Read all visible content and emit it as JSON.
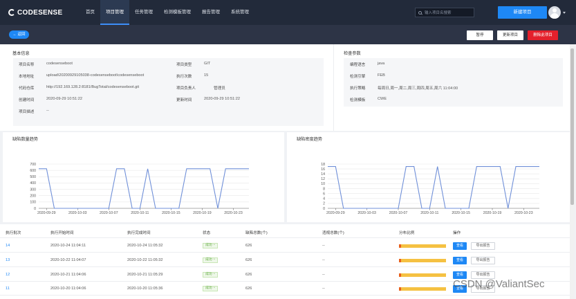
{
  "brand": {
    "name": "CODESENSE"
  },
  "nav": {
    "items": [
      "首页",
      "项目管理",
      "任务管理",
      "检测模板管理",
      "报告管理",
      "系统管理"
    ]
  },
  "search": {
    "placeholder": "输入项目名搜索"
  },
  "header": {
    "new_project_label": "新建项目"
  },
  "subbar": {
    "back_label": "← 返回",
    "pause_label": "暂停",
    "update_label": "更新项目",
    "delete_label": "删除此项目"
  },
  "basic_info": {
    "title": "基本信息",
    "fields": {
      "project_name": {
        "label": "项目名称",
        "value": "codesenseboot"
      },
      "local_address": {
        "label": "本地地址",
        "value": "upload\\20200929105038-codesenseboot\\codesenseboot"
      },
      "repo": {
        "label": "代码仓库",
        "value": "http://192.169.128.2:8181/BugTotal/codesenseboot.git"
      },
      "created_at": {
        "label": "创建时间",
        "value": "2020-09-29 10:51:22"
      },
      "description": {
        "label": "项目描述",
        "value": "--"
      },
      "project_type": {
        "label": "项目类型",
        "value": "GIT"
      },
      "exec_count": {
        "label": "执行次数",
        "value": "15"
      },
      "owner": {
        "label": "项目负责人",
        "value": "管理员"
      },
      "updated_at": {
        "label": "更新时间",
        "value": "2020-09-29 10:51:22"
      }
    }
  },
  "check_params": {
    "title": "检查参数",
    "fields": {
      "language": {
        "label": "编程语言",
        "value": "java"
      },
      "engine": {
        "label": "检测引擎",
        "value": "FEB"
      },
      "strategy": {
        "label": "执行策略",
        "value": "每周日,周一,周二,周三,周四,周五,周六 11:04:00"
      },
      "template": {
        "label": "检测模板",
        "value": "CWE"
      }
    }
  },
  "charts_meta": {
    "left_title": "缺陷数量趋势",
    "right_title": "缺陷密度趋势"
  },
  "chart_data": [
    {
      "type": "line",
      "title": "缺陷数量趋势",
      "xlabel": "",
      "ylabel": "",
      "x_ticks": [
        "2020-09-29",
        "2020-10-03",
        "2020-10-07",
        "2020-10-11",
        "2020-10-15",
        "2020-10-19",
        "2020-10-23"
      ],
      "x_range": [
        "2020-09-28",
        "2020-10-25"
      ],
      "y_ticks": [
        0,
        100,
        200,
        300,
        400,
        500,
        600,
        700
      ],
      "ylim": [
        0,
        700
      ],
      "grid": true,
      "color": "#6f8fd8",
      "series": [
        {
          "x": [
            "2020-09-28",
            "2020-09-29",
            "2020-09-30",
            "2020-10-01",
            "2020-10-02",
            "2020-10-03",
            "2020-10-04",
            "2020-10-05",
            "2020-10-06",
            "2020-10-07",
            "2020-10-08",
            "2020-10-09",
            "2020-10-10",
            "2020-10-11",
            "2020-10-12",
            "2020-10-13",
            "2020-10-14",
            "2020-10-15",
            "2020-10-16",
            "2020-10-17",
            "2020-10-18",
            "2020-10-19",
            "2020-10-20",
            "2020-10-21",
            "2020-10-22",
            "2020-10-23",
            "2020-10-24",
            "2020-10-25"
          ],
          "y": [
            626,
            626,
            0,
            0,
            0,
            0,
            0,
            0,
            0,
            0,
            626,
            626,
            0,
            0,
            626,
            0,
            0,
            0,
            0,
            626,
            626,
            626,
            626,
            0,
            626,
            626,
            626,
            626
          ]
        }
      ]
    },
    {
      "type": "line",
      "title": "缺陷密度趋势",
      "xlabel": "",
      "ylabel": "",
      "x_ticks": [
        "2020-09-29",
        "2020-10-03",
        "2020-10-07",
        "2020-10-11",
        "2020-10-15",
        "2020-10-19",
        "2020-10-23"
      ],
      "x_range": [
        "2020-09-28",
        "2020-10-25"
      ],
      "y_ticks": [
        0,
        2,
        4,
        6,
        8,
        10,
        12,
        14,
        16,
        18
      ],
      "ylim": [
        0,
        18
      ],
      "grid": true,
      "color": "#6f8fd8",
      "series": [
        {
          "x": [
            "2020-09-28",
            "2020-09-29",
            "2020-09-30",
            "2020-10-01",
            "2020-10-02",
            "2020-10-03",
            "2020-10-04",
            "2020-10-05",
            "2020-10-06",
            "2020-10-07",
            "2020-10-08",
            "2020-10-09",
            "2020-10-10",
            "2020-10-11",
            "2020-10-12",
            "2020-10-13",
            "2020-10-14",
            "2020-10-15",
            "2020-10-16",
            "2020-10-17",
            "2020-10-18",
            "2020-10-19",
            "2020-10-20",
            "2020-10-21",
            "2020-10-22",
            "2020-10-23",
            "2020-10-24",
            "2020-10-25"
          ],
          "y": [
            17,
            17,
            0,
            0,
            0,
            0,
            0,
            0,
            0,
            0,
            17,
            17,
            0,
            0,
            17,
            0,
            0,
            0,
            0,
            17,
            17,
            17,
            17,
            0,
            17,
            17,
            17,
            17
          ]
        }
      ]
    }
  ],
  "table": {
    "headers": [
      "执行批次",
      "执行开始时间",
      "执行完成时间",
      "状态",
      "缺陷总数(个)",
      "违规总数(个)",
      "分布比例",
      "操作"
    ],
    "view_label": "查看",
    "export_label": "导出报告",
    "rows": [
      {
        "batch": "14",
        "start": "2020-10-24 11:04:11",
        "end": "2020-10-24 11:05:32",
        "status": "成功 ◔",
        "defects": "626",
        "violations": "--",
        "distribution": 0.04
      },
      {
        "batch": "13",
        "start": "2020-10-22 11:04:07",
        "end": "2020-10-22 11:05:32",
        "status": "成功 ◔",
        "defects": "626",
        "violations": "--",
        "distribution": 0.04
      },
      {
        "batch": "12",
        "start": "2020-10-21 11:04:06",
        "end": "2020-10-21 11:05:29",
        "status": "成功 ◔",
        "defects": "626",
        "violations": "--",
        "distribution": 0.04
      },
      {
        "batch": "11",
        "start": "2020-10-20 11:04:06",
        "end": "2020-10-20 11:05:36",
        "status": "成功 ◔",
        "defects": "626",
        "violations": "--",
        "distribution": 0.04
      }
    ]
  },
  "watermark": "CSDN @ValiantSec"
}
